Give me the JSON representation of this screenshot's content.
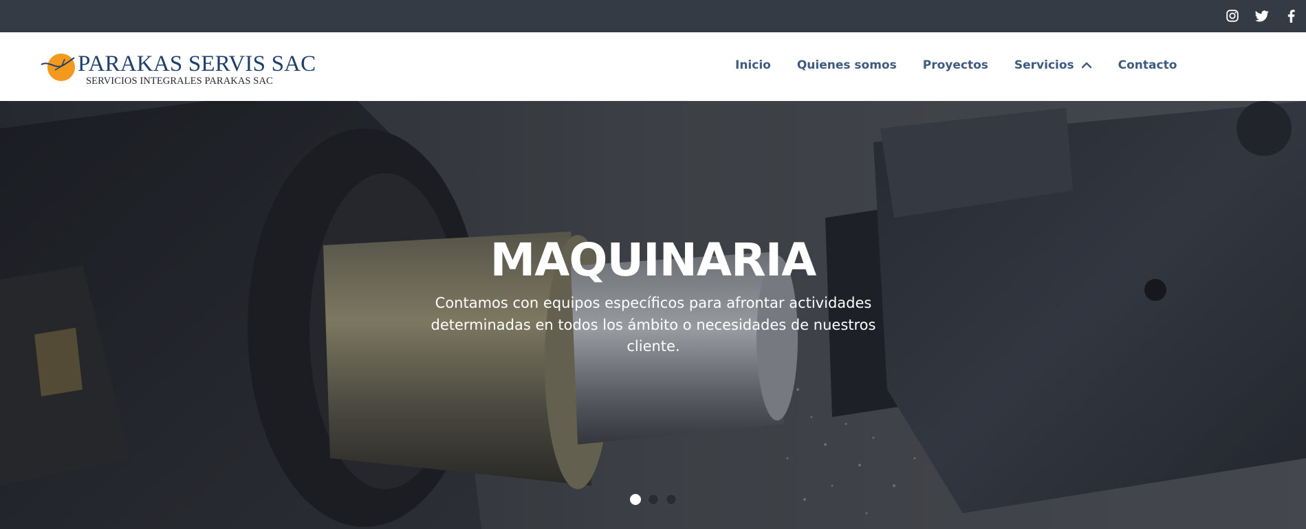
{
  "topbar": {
    "social": [
      {
        "icon": "instagram-icon"
      },
      {
        "icon": "twitter-icon"
      },
      {
        "icon": "facebook-icon"
      }
    ]
  },
  "logo": {
    "title": "PARAKAS SERVIS SAC",
    "subtitle": "SERVICIOS INTEGRALES PARAKAS SAC"
  },
  "nav": {
    "items": [
      {
        "label": "Inicio"
      },
      {
        "label": "Quienes somos"
      },
      {
        "label": "Proyectos"
      },
      {
        "label": "Servicios",
        "icon": "chevron-up-icon"
      },
      {
        "label": "Contacto"
      }
    ]
  },
  "hero": {
    "title": "MAQUINARIA",
    "text": "Contamos con equipos específicos para afrontar actividades determinadas en todos los ámbito o necesidades de nuestros cliente.",
    "slides_total": 3,
    "active_slide": 1
  },
  "colors": {
    "topbar": "#353b45",
    "nav_text": "#3d5a80",
    "logo_blue": "#1e3f6e",
    "logo_orange": "#f39a1e"
  }
}
